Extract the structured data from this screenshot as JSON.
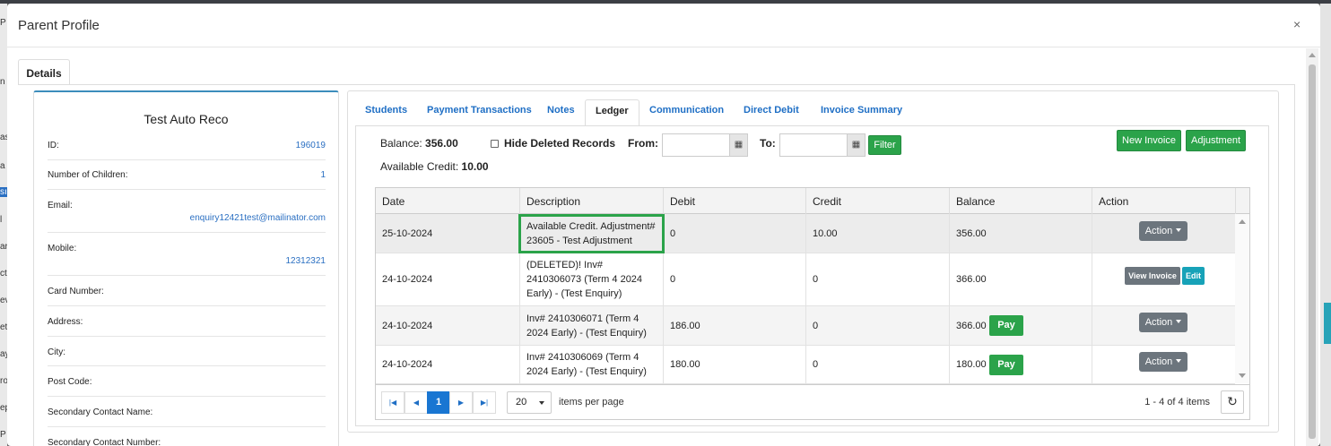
{
  "background_fragments": [
    "P",
    "n",
    "as",
    "a",
    "sı",
    "l",
    "ar",
    "ct",
    "ev",
    "et",
    "ay",
    "ro",
    "ep",
    "P"
  ],
  "modal": {
    "title": "Parent Profile",
    "close": "×",
    "outer_tab": "Details"
  },
  "profile": {
    "name": "Test Auto Reco",
    "fields": [
      {
        "label": "ID:",
        "value": "196019"
      },
      {
        "label": "Number of Children:",
        "value": "1"
      },
      {
        "label": "Email:",
        "value": "enquiry12421test@mailinator.com"
      },
      {
        "label": "Mobile:",
        "value": "12312321"
      },
      {
        "label": "Card Number:",
        "value": ""
      },
      {
        "label": "Address:",
        "value": ""
      },
      {
        "label": "City:",
        "value": ""
      },
      {
        "label": "Post Code:",
        "value": ""
      },
      {
        "label": "Secondary Contact Name:",
        "value": ""
      },
      {
        "label": "Secondary Contact Number:",
        "value": ""
      }
    ]
  },
  "tabs": [
    "Students",
    "Payment Transactions",
    "Notes",
    "Ledger",
    "Communication",
    "Direct Debit",
    "Invoice Summary"
  ],
  "active_tab": "Ledger",
  "ledger": {
    "balance_label": "Balance:",
    "balance_value": "356.00",
    "available_credit_label": "Available Credit:",
    "available_credit_value": "10.00",
    "hide_deleted_label": "Hide Deleted Records",
    "hide_deleted_checked": false,
    "from_label": "From:",
    "to_label": "To:",
    "from_value": "",
    "to_value": "",
    "filter_button": "Filter",
    "new_invoice_button": "New Invoice",
    "adjustment_button": "Adjustment",
    "columns": [
      "Date",
      "Description",
      "Debit",
      "Credit",
      "Balance",
      "Action"
    ],
    "rows": [
      {
        "date": "25-10-2024",
        "description": "Available Credit. Adjustment# 23605 - Test Adjustment",
        "debit": "0",
        "credit": "10.00",
        "balance": "356.00",
        "action": "Action",
        "highlighted": true
      },
      {
        "date": "24-10-2024",
        "description": "(DELETED)! Inv# 2410306073 (Term 4 2024 Early) - (Test Enquiry)",
        "debit": "0",
        "credit": "0",
        "balance": "366.00",
        "view_invoice": "View Invoice",
        "edit": "Edit"
      },
      {
        "date": "24-10-2024",
        "description": "Inv# 2410306071 (Term 4 2024 Early) - (Test Enquiry)",
        "debit": "186.00",
        "credit": "0",
        "balance": "366.00",
        "pay": "Pay",
        "action": "Action"
      },
      {
        "date": "24-10-2024",
        "description": "Inv# 2410306069 (Term 4 2024 Early) - (Test Enquiry)",
        "debit": "180.00",
        "credit": "0",
        "balance": "180.00",
        "pay": "Pay",
        "action": "Action"
      }
    ],
    "pager": {
      "current_page": "1",
      "page_size": "20",
      "items_per_page_label": "items per page",
      "info": "1 - 4 of 4 items"
    }
  },
  "colors": {
    "accent_green": "#2ba34a",
    "link_blue": "#1f6fc5",
    "edit_teal": "#17a2b8",
    "action_grey": "#6c757d"
  },
  "icons": [
    "close-icon",
    "calendar-icon",
    "first-page-icon",
    "prev-page-icon",
    "next-page-icon",
    "last-page-icon",
    "refresh-icon",
    "caret-down-icon"
  ]
}
